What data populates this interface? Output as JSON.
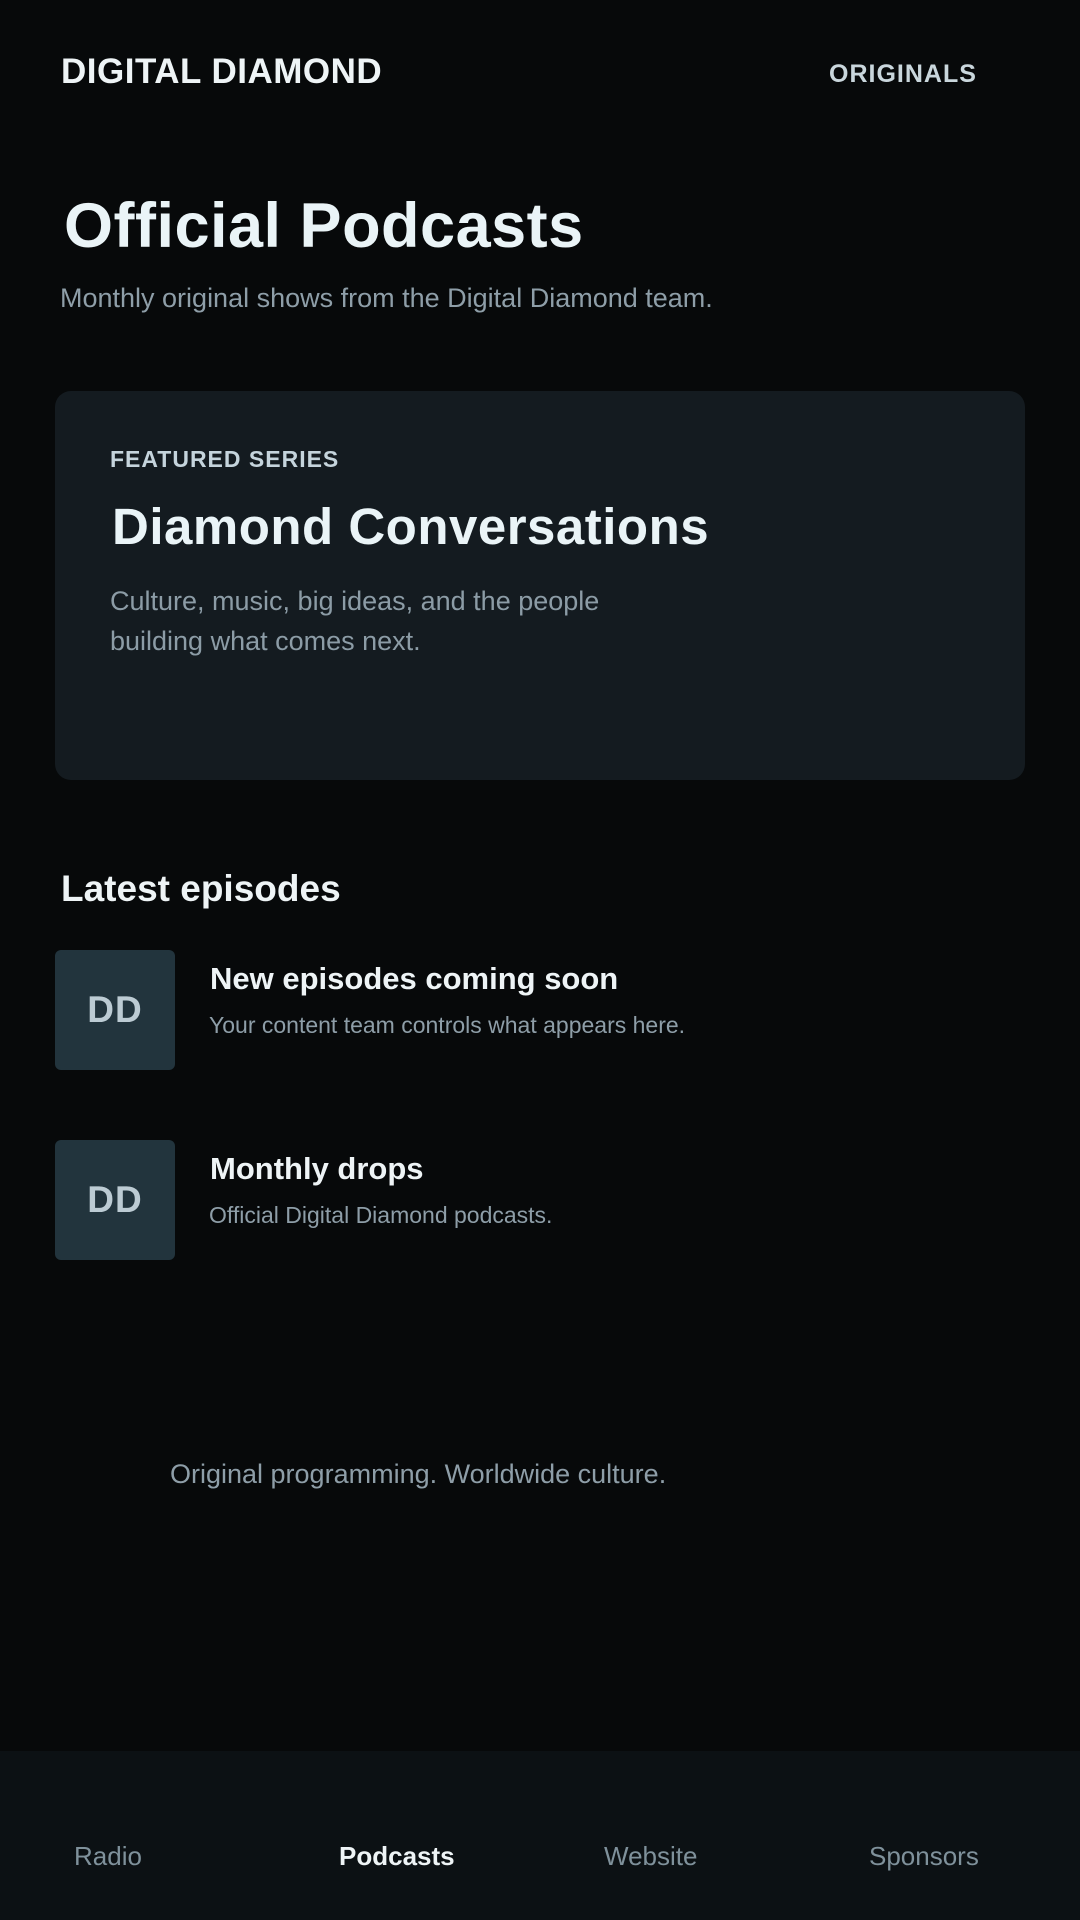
{
  "header": {
    "brand": "DIGITAL DIAMOND",
    "nav_link": "ORIGINALS"
  },
  "hero": {
    "title": "Official Podcasts",
    "subtitle": "Monthly original shows from the Digital Diamond team."
  },
  "featured": {
    "eyebrow": "FEATURED SERIES",
    "title": "Diamond Conversations",
    "description": "Culture, music, big ideas, and the people building what comes next."
  },
  "latest": {
    "heading": "Latest episodes",
    "episodes": [
      {
        "thumb": "DD",
        "title": "New episodes coming soon",
        "description": "Your content team controls what appears here."
      },
      {
        "thumb": "DD",
        "title": "Monthly drops",
        "description": "Official Digital Diamond podcasts."
      }
    ]
  },
  "tagline": "Original programming. Worldwide culture.",
  "bottom_nav": {
    "items": [
      {
        "label": "Radio",
        "active": false
      },
      {
        "label": "Podcasts",
        "active": true
      },
      {
        "label": "Website",
        "active": false
      },
      {
        "label": "Sponsors",
        "active": false
      }
    ]
  },
  "colors": {
    "background": "#07090a",
    "card": "#141b20",
    "thumb": "#22343d",
    "nav_bar": "#0c1114",
    "text_primary": "#eef4f6",
    "text_muted": "#8e9ea8"
  }
}
